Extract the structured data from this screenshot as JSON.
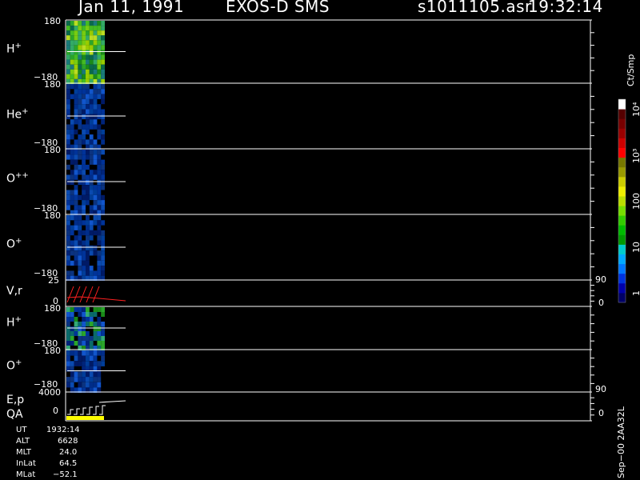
{
  "header": {
    "date": "Jan 11, 1991",
    "mission": "EXOS-D SMS",
    "file": "s1011105.asr",
    "time": "19:32:14"
  },
  "colorbar": {
    "title": "Ct/Smp",
    "tick_labels": [
      "1",
      "10",
      "100",
      "10³",
      "10⁴"
    ],
    "colors": [
      "#000066",
      "#0000aa",
      "#0033dd",
      "#0077ff",
      "#00aaff",
      "#00cccc",
      "#009900",
      "#00bb00",
      "#33cc00",
      "#77dd00",
      "#bbdd00",
      "#eeee00",
      "#cccc00",
      "#999900",
      "#777700",
      "#ff0000",
      "#cc0000",
      "#990000",
      "#770000",
      "#550000",
      "#ffffff"
    ]
  },
  "panels": [
    {
      "label": "H",
      "sup": "+",
      "ymax": "180",
      "ymin": "−180",
      "palette": "green"
    },
    {
      "label": "He",
      "sup": "+",
      "ymax": "180",
      "ymin": "−180",
      "palette": "blue"
    },
    {
      "label": "O",
      "sup": "++",
      "ymax": "180",
      "ymin": "−180",
      "palette": "blue"
    },
    {
      "label": "O",
      "sup": "+",
      "ymax": "180",
      "ymin": "−180",
      "palette": "blue"
    },
    {
      "label": "V,r",
      "sup": "",
      "ymax": "25",
      "ymin": "0",
      "right_top": "90",
      "right_bottom": "0"
    },
    {
      "label": "H",
      "sup": "+",
      "ymax": "180",
      "ymin": "−180",
      "palette": "mixed"
    },
    {
      "label": "O",
      "sup": "+",
      "ymax": "180",
      "ymin": "−180",
      "palette": "blue"
    },
    {
      "label": "E,p",
      "label2": "QA",
      "sup": "",
      "ymax": "4000",
      "ymin": "0",
      "right_top": "90",
      "right_bottom": "0"
    }
  ],
  "info": [
    {
      "key": "UT",
      "value": "1932:14"
    },
    {
      "key": "ALT",
      "value": "6628"
    },
    {
      "key": "MLT",
      "value": "24.0"
    },
    {
      "key": "InLat",
      "value": "64.5"
    },
    {
      "key": "MLat",
      "value": "−52.1"
    }
  ],
  "footer": {
    "version": "Sep−00  2AA32L"
  },
  "colors": {
    "frame": "#ffffff",
    "trace_red": "#ff2020",
    "qa_bar": "#ffff00"
  }
}
